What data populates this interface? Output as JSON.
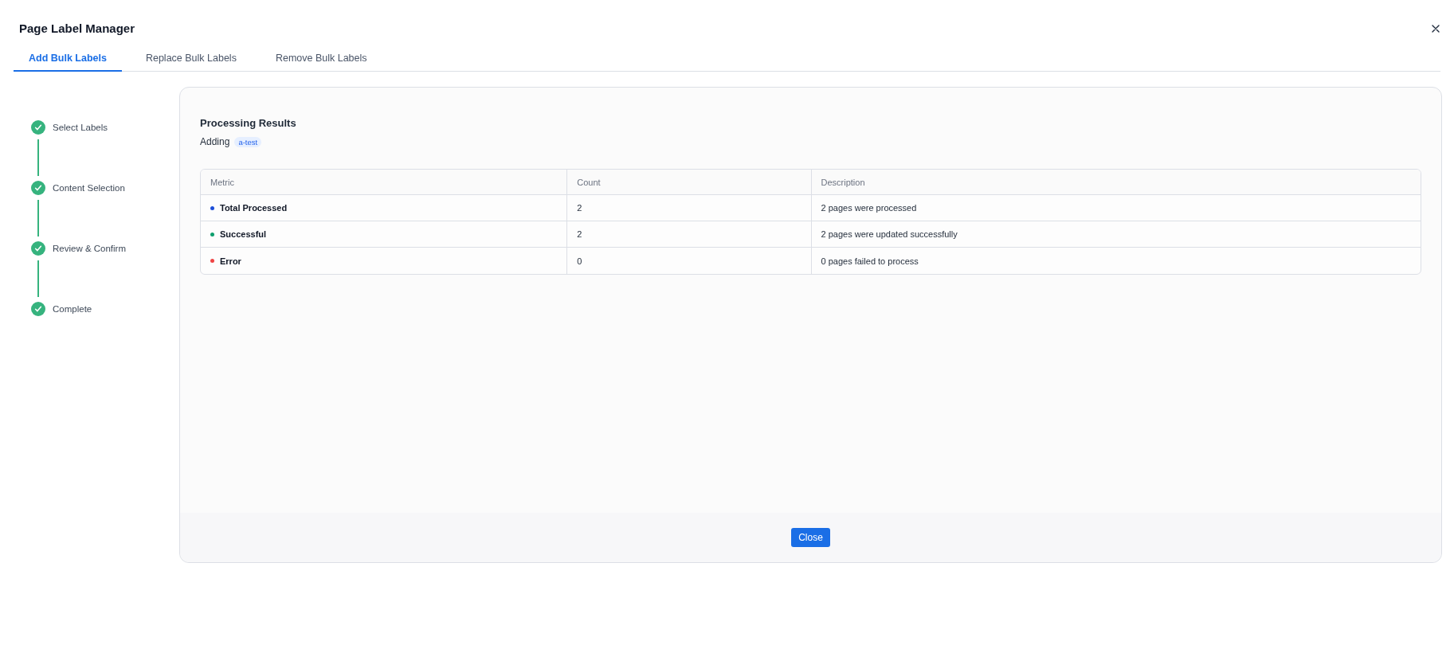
{
  "window": {
    "title": "Page Label Manager"
  },
  "tabs": [
    {
      "label": "Add Bulk Labels",
      "selected": true
    },
    {
      "label": "Replace Bulk Labels",
      "selected": false
    },
    {
      "label": "Remove Bulk Labels",
      "selected": false
    }
  ],
  "steps": [
    {
      "label": "Select Labels",
      "completed": true
    },
    {
      "label": "Content Selection",
      "completed": true
    },
    {
      "label": "Review & Confirm",
      "completed": true
    },
    {
      "label": "Complete",
      "completed": true
    }
  ],
  "results": {
    "title": "Processing Results",
    "action": "Adding",
    "label_tag": "a-test",
    "table": {
      "columns": [
        "Metric",
        "Count",
        "Description"
      ],
      "rows": [
        {
          "metric": "Total Processed",
          "color": "#1d4ed8",
          "count": "2",
          "description": "2 pages were processed"
        },
        {
          "metric": "Successful",
          "color": "#0f9f6e",
          "count": "2",
          "description": "2 pages were updated successfully"
        },
        {
          "metric": "Error",
          "color": "#ef4444",
          "count": "0",
          "description": "0 pages failed to process"
        }
      ]
    }
  },
  "footer": {
    "buttons": [
      "Close"
    ]
  }
}
